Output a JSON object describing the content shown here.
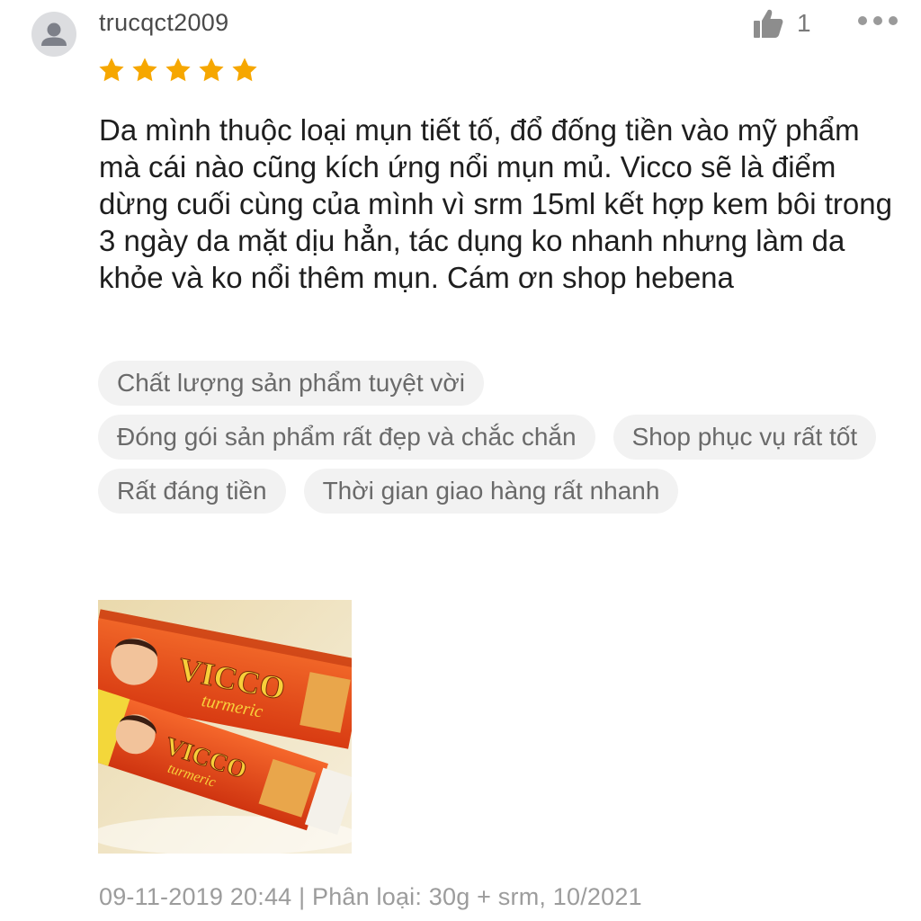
{
  "user": {
    "name": "trucqct2009",
    "avatar_icon": "user-avatar-icon"
  },
  "like": {
    "icon": "thumbs-up-icon",
    "count": "1"
  },
  "more_icon": "more-options-icon",
  "rating": {
    "value": 5,
    "max": 5,
    "color": "#f6a700"
  },
  "review": {
    "text": "Da mình thuộc loại mụn tiết tố, đổ đống tiền vào mỹ phẩm mà cái nào cũng kích ứng nổi mụn mủ. Vicco sẽ là điểm dừng cuối cùng của mình vì srm 15ml kết hợp kem bôi trong 3 ngày da mặt dịu hẳn, tác dụng ko nhanh nhưng làm da khỏe và ko nổi thêm mụn. Cám ơn shop hebena"
  },
  "tags": [
    "Chất lượng sản phẩm tuyệt vời",
    "Đóng gói sản phẩm rất đẹp và chắc chắn",
    "Shop phục vụ rất tốt",
    "Rất đáng tiền",
    "Thời gian giao hàng rất nhanh"
  ],
  "photo": {
    "brand": "VICCO",
    "subtitle": "turmeric"
  },
  "footer": {
    "text": "09-11-2019 20:44 | Phân loại: 30g + srm, 10/2021"
  }
}
